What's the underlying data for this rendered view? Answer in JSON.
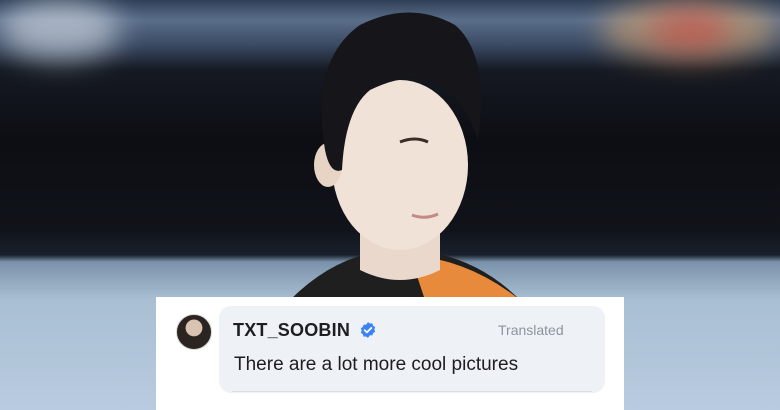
{
  "comment": {
    "username": "TXT_SOOBIN",
    "translated_label": "Translated",
    "text": "There are a lot more cool pictures",
    "verified_icon": "verified-badge-icon",
    "accent_color": "#3b82f6"
  }
}
